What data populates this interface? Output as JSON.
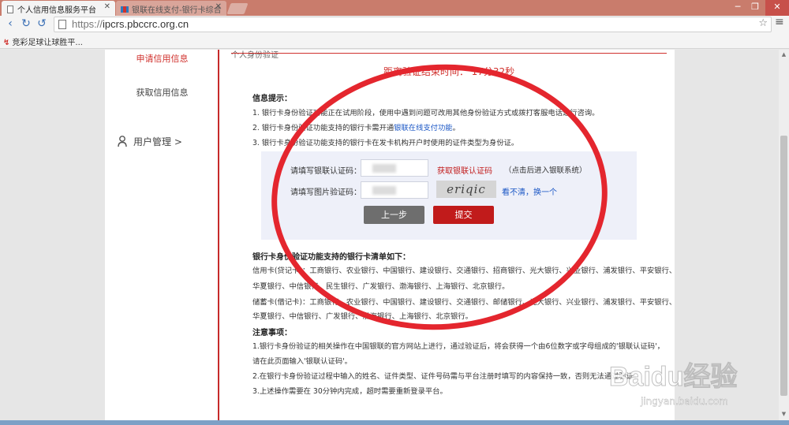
{
  "browser": {
    "tabs": [
      {
        "label": "个人信用信息服务平台",
        "active": true
      },
      {
        "label": "银联在线支付-银行卡综合",
        "active": false
      }
    ],
    "url_scheme": "https://",
    "url_host": "ipcrs.pbccrc.org.cn",
    "bookmark": "竞彩足球让球胜平...",
    "window_controls": [
      "─",
      "❐",
      "✕"
    ]
  },
  "sidebar": {
    "items": [
      {
        "label": "申请信用信息",
        "active": true
      },
      {
        "label": "获取信用信息"
      },
      {
        "label": "用户管理 >"
      }
    ]
  },
  "section_stub": "个人身份验证",
  "timer": "距离验证结束时间： 17分32秒",
  "info": {
    "title": "信息提示：",
    "line1": "1. 银行卡身份验证功能正在试用阶段，使用中遇到问题可改用其他身份验证方式或拨打客服电话进行咨询。",
    "line2_prefix": "2. 银行卡身份验证功能支持的银行卡需开通",
    "line2_link": "银联在线支付功能",
    "line2_suffix": "。",
    "line3": "3. 银行卡身份验证功能支持的银行卡在发卡机构开户时使用的证件类型为身份证。"
  },
  "form": {
    "unionpay_label": "请填写银联认证码：",
    "get_code_link": "获取银联认证码",
    "get_code_hint": "（点击后进入银联系统）",
    "captcha_label": "请填写图片验证码：",
    "captcha_text": "eriqic",
    "refresh_link": "看不清，换一个",
    "back_button": "上一步",
    "submit_button": "提交"
  },
  "bank_list": {
    "title": "银行卡身份验证功能支持的银行卡清单如下：",
    "credit_line1": "信用卡(贷记卡)：工商银行、农业银行、中国银行、建设银行、交通银行、招商银行、光大银行、兴业银行、浦发银行、平安银行、",
    "credit_line2": "华夏银行、中信银行、民生银行、广发银行、渤海银行、上海银行、北京银行。",
    "debit_line1": "储蓄卡(借记卡)：工商银行、农业银行、中国银行、建设银行、交通银行、邮储银行、光大银行、兴业银行、浦发银行、平安银行、",
    "debit_line2": "华夏银行、中信银行、广发银行、渤海银行、上海银行、北京银行。"
  },
  "notes": {
    "title": "注意事项：",
    "line1": "1.银行卡身份验证的相关操作在中国银联的官方网站上进行，通过验证后，将会获得一个由6位数字或字母组成的'银联认证码'，",
    "line2": "请在此页面输入'银联认证码'。",
    "line3": "2.在银行卡身份验证过程中输入的姓名、证件类型、证件号码需与平台注册时填写的内容保持一致，否则无法通过验证。",
    "line4": "3.上述操作需要在 30分钟内完成，超时需要重新登录平台。"
  },
  "watermark": {
    "logo": "Baidu经验",
    "url": "jingyan.baidu.com"
  },
  "colors": {
    "accent_red": "#d0312d",
    "link_blue": "#1a56c5",
    "form_bg": "#eef0f9",
    "tabbar": "#c97c6c",
    "annotation_circle": "#e4262e"
  }
}
